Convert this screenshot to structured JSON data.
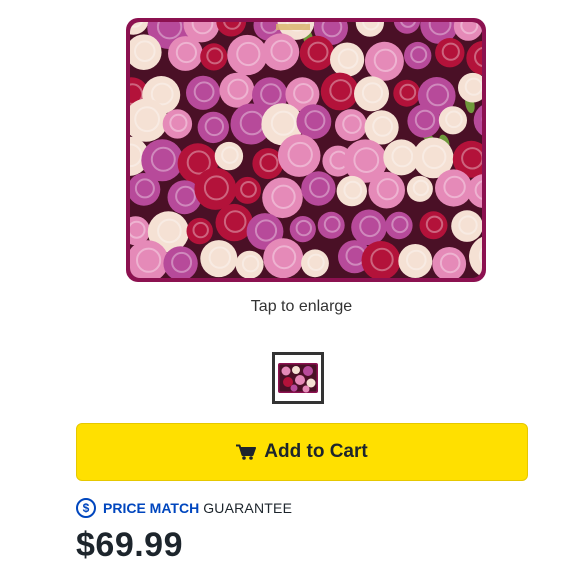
{
  "product": {
    "image_alt": "floral laptop sleeve",
    "image_colors": {
      "border": "#8c1150",
      "background": "#4a1026",
      "rose_pink": "#e58ab8",
      "rose_purple": "#b74a9a",
      "rose_red": "#b3123a",
      "rose_cream": "#f5e1d4",
      "leaf": "#6f9a3c"
    }
  },
  "gallery": {
    "tap_label": "Tap to enlarge"
  },
  "cart": {
    "icon": "cart-icon",
    "label": "Add to Cart",
    "color": "#ffe000"
  },
  "price_match": {
    "icon": "dollar-circle-icon",
    "symbol": "$",
    "bold_text": "PRICE MATCH",
    "light_text": "GUARANTEE",
    "color": "#0046be"
  },
  "price": {
    "value": "$69.99"
  }
}
